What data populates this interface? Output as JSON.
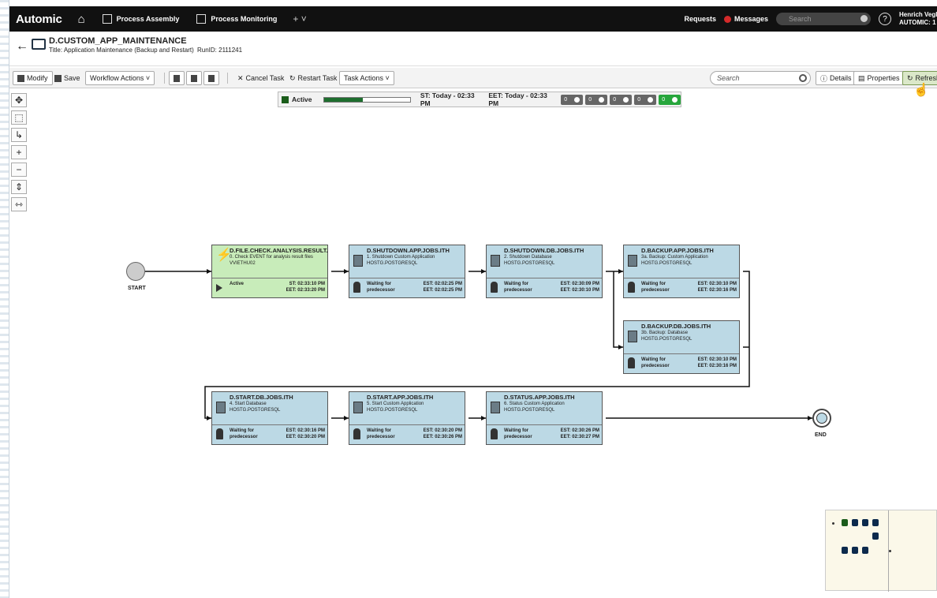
{
  "topnav": {
    "brand": "Automic",
    "home_icon": "home-icon",
    "process_assembly": "Process Assembly",
    "process_monitoring": "Process Monitoring",
    "add_tab": "+ ˅",
    "requests": "Requests",
    "messages": "Messages",
    "search_placeholder": "Search",
    "help": "?",
    "user_name": "Henrich Vegh",
    "user_system": "AUTOMIC: 1"
  },
  "object": {
    "name": "D.CUSTOM_APP_MAINTENANCE",
    "title": "Title: Application Maintenance (Backup and Restart)",
    "runid": "RunID: 2111241"
  },
  "toolbar": {
    "modify": "Modify",
    "save": "Save",
    "workflow_actions": "Workflow Actions ˅",
    "cancel_task": "Cancel Task",
    "restart_task": "Restart Task",
    "task_actions": "Task Actions ˅",
    "search_placeholder": "Search",
    "details": "Details",
    "properties": "Properties",
    "refresh": "Refresh"
  },
  "status": {
    "state": "Active",
    "progress": 0.45,
    "start_time": "ST: Today - 02:33 PM",
    "end_time": "EET: Today - 02:33 PM",
    "counters": [
      "0",
      "0",
      "0",
      "0",
      "0"
    ]
  },
  "start_label": "START",
  "end_label": "END",
  "nodes": [
    {
      "name": "D.FILE.CHECK.ANALYSIS.RESULT...",
      "desc": "0. Check EVENT for analysis result files",
      "host": "VVIETHU02",
      "status": "Active",
      "t1": "ST: 02:33:10 PM",
      "t2": "EET: 02:33:20 PM"
    },
    {
      "name": "D.SHUTDOWN.APP.JOBS.ITH",
      "desc": "1. Shutdown Custom Application",
      "host": "HOSTG.POSTGRESQL",
      "status": "Waiting for predecessor",
      "t1": "EST: 02:02:25 PM",
      "t2": "EET: 02:02:25 PM"
    },
    {
      "name": "D.SHUTDOWN.DB.JOBS.ITH",
      "desc": "2. Shutdown Database",
      "host": "HOSTG.POSTGRESQL",
      "status": "Waiting for predecessor",
      "t1": "EST: 02:30:09 PM",
      "t2": "EET: 02:30:10 PM"
    },
    {
      "name": "D.BACKUP.APP.JOBS.ITH",
      "desc": "3a. Backup: Custom Application",
      "host": "HOSTG.POSTGRESQL",
      "status": "Waiting for predecessor",
      "t1": "EST: 02:30:10 PM",
      "t2": "EET: 02:30:16 PM"
    },
    {
      "name": "D.BACKUP.DB.JOBS.ITH",
      "desc": "3b. Backup: Database",
      "host": "HOSTG.POSTGRESQL",
      "status": "Waiting for predecessor",
      "t1": "EST: 02:30:10 PM",
      "t2": "EET: 02:30:16 PM"
    },
    {
      "name": "D.START.DB.JOBS.ITH",
      "desc": "4. Start Database",
      "host": "HOSTG.POSTGRESQL",
      "status": "Waiting for predecessor",
      "t1": "EST: 02:30:16 PM",
      "t2": "EET: 02:30:20 PM"
    },
    {
      "name": "D.START.APP.JOBS.ITH",
      "desc": "5. Start Custom Application",
      "host": "HOSTG.POSTGRESQL",
      "status": "Waiting for predecessor",
      "t1": "EST: 02:30:20 PM",
      "t2": "EET: 02:30:26 PM"
    },
    {
      "name": "D.STATUS.APP.JOBS.ITH",
      "desc": "6. Status Custom Application",
      "host": "HOSTG.POSTGRESQL",
      "status": "Waiting for predecessor",
      "t1": "EST: 02:30:26 PM",
      "t2": "EET: 02:30:27 PM"
    }
  ],
  "colors": {
    "topbar": "#111111",
    "active_node": "#c8ecba",
    "waiting_node": "#bcd9e5",
    "active_status": "#1a5c1a"
  }
}
